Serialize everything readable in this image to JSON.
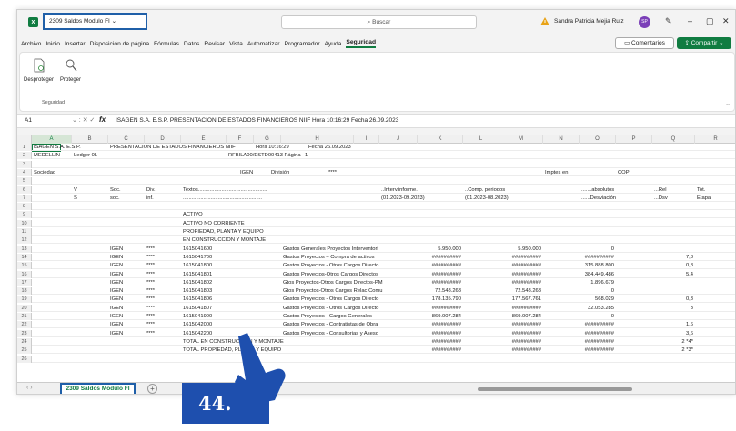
{
  "window": {
    "doc_title": "2309 Saldos Modulo FI",
    "search_placeholder": "Buscar",
    "user_name": "Sandra Patricia Mejia Ruiz",
    "avatar_initials": "SP"
  },
  "menu": {
    "items": [
      "Archivo",
      "Inicio",
      "Insertar",
      "Disposición de página",
      "Fórmulas",
      "Datos",
      "Revisar",
      "Vista",
      "Automatizar",
      "Programador",
      "Ayuda",
      "Seguridad"
    ],
    "comments_label": "Comentarios",
    "share_label": "Compartir"
  },
  "ribbon": {
    "unprotect_label": "Desproteger",
    "protect_label": "Proteger",
    "group_label": "Seguridad"
  },
  "formula_bar": {
    "name_box": "A1",
    "fx": "fx",
    "content": "ISAGEN S.A. E.S.P.          PRESENTACION DE ESTADOS FINANCIEROS NIIF          Hora 10:16:29   Fecha 26.09.2023"
  },
  "sheet": {
    "columns": [
      "A",
      "B",
      "C",
      "D",
      "E",
      "F",
      "G",
      "H",
      "I",
      "J",
      "K",
      "L",
      "M",
      "N",
      "O",
      "P",
      "Q",
      "R"
    ],
    "rows": [
      {
        "n": "1",
        "cells": [
          [
            "A",
            "ISAGEN S.A. E.S.P."
          ],
          [
            "C",
            "PRESENTACION DE ESTADOS FINANCIEROS NIIF"
          ],
          [
            "G",
            "Hora 10:16:29"
          ],
          [
            "H2",
            "Fecha 26.09.2023"
          ]
        ]
      },
      {
        "n": "2",
        "cells": [
          [
            "A",
            "MEDELLIN"
          ],
          [
            "B",
            "Ledger 0L"
          ],
          [
            "E2",
            "RFBILA00/ESTD00413 Página"
          ],
          [
            "G2",
            "1"
          ]
        ]
      },
      {
        "n": "3",
        "cells": []
      },
      {
        "n": "4",
        "cells": [
          [
            "A",
            "Sociedad"
          ],
          [
            "F0",
            "IGEN"
          ],
          [
            "G0",
            "División"
          ],
          [
            "H3",
            "****"
          ],
          [
            "N",
            "Imptes en"
          ],
          [
            "P",
            "COP"
          ]
        ]
      },
      {
        "n": "5",
        "cells": []
      },
      {
        "n": "6",
        "cells": [
          [
            "B",
            "V"
          ],
          [
            "C",
            "Soc."
          ],
          [
            "D",
            "Div."
          ],
          [
            "E",
            "Textos..............................................."
          ],
          [
            "J",
            "..Interv.informe."
          ],
          [
            "L",
            "..Comp. periodos"
          ],
          [
            "O",
            ".......absolutos"
          ],
          [
            "Q",
            "...Rel"
          ],
          [
            "R",
            "Tot."
          ]
        ]
      },
      {
        "n": "7",
        "cells": [
          [
            "B",
            "S"
          ],
          [
            "C",
            "soc."
          ],
          [
            "D",
            "inf."
          ],
          [
            "E",
            "......................................................"
          ],
          [
            "J",
            "(01.2023-09.2023)"
          ],
          [
            "L",
            "(01.2023-08.2023)"
          ],
          [
            "O",
            "......Desviación"
          ],
          [
            "Q",
            "...Dsv"
          ],
          [
            "R",
            "Etapa"
          ]
        ]
      },
      {
        "n": "8",
        "cells": []
      },
      {
        "n": "9",
        "cells": [
          [
            "E",
            "ACTIVO"
          ]
        ]
      },
      {
        "n": "10",
        "cells": [
          [
            "E",
            "ACTIVO NO CORRIENTE"
          ]
        ]
      },
      {
        "n": "11",
        "cells": [
          [
            "E",
            "PROPIEDAD, PLANTA Y EQUIPO"
          ]
        ]
      },
      {
        "n": "12",
        "cells": [
          [
            "E",
            "EN CONSTRUCCION Y MONTAJE"
          ]
        ]
      },
      {
        "n": "13",
        "cells": [
          [
            "C",
            "IGEN"
          ],
          [
            "D",
            "****"
          ],
          [
            "E",
            "1615041600"
          ],
          [
            "H",
            "Gastos Generales Proyectos Interventori"
          ],
          [
            "Kr",
            "5.950.000"
          ],
          [
            "Mr",
            "5.950.000"
          ],
          [
            "Or",
            "0"
          ]
        ]
      },
      {
        "n": "14",
        "cells": [
          [
            "C",
            "IGEN"
          ],
          [
            "D",
            "****"
          ],
          [
            "E",
            "1615041700"
          ],
          [
            "H",
            "Gastos Proyectos – Compra de activos"
          ],
          [
            "Kr",
            "##########"
          ],
          [
            "Mr",
            "##########"
          ],
          [
            "Or",
            "##########"
          ],
          [
            "Qr",
            "7,8"
          ]
        ]
      },
      {
        "n": "15",
        "cells": [
          [
            "C",
            "IGEN"
          ],
          [
            "D",
            "****"
          ],
          [
            "E",
            "1615041800"
          ],
          [
            "H",
            "Gastos Proyectos - Otros Cargos Directo"
          ],
          [
            "Kr",
            "##########"
          ],
          [
            "Mr",
            "##########"
          ],
          [
            "Or",
            "315.888.800"
          ],
          [
            "Qr",
            "0,8"
          ]
        ]
      },
      {
        "n": "16",
        "cells": [
          [
            "C",
            "IGEN"
          ],
          [
            "D",
            "****"
          ],
          [
            "E",
            "1615041801"
          ],
          [
            "H",
            "Gastos Proyectos-Otros Cargos Directos"
          ],
          [
            "Kr",
            "##########"
          ],
          [
            "Mr",
            "##########"
          ],
          [
            "Or",
            "384.449.486"
          ],
          [
            "Qr",
            "5,4"
          ]
        ]
      },
      {
        "n": "17",
        "cells": [
          [
            "C",
            "IGEN"
          ],
          [
            "D",
            "****"
          ],
          [
            "E",
            "1615041802"
          ],
          [
            "H",
            "Gtos Proyectos-Otros Cargos Directos-PM"
          ],
          [
            "Kr",
            "##########"
          ],
          [
            "Mr",
            "##########"
          ],
          [
            "Or",
            "1.896.679"
          ]
        ]
      },
      {
        "n": "18",
        "cells": [
          [
            "C",
            "IGEN"
          ],
          [
            "D",
            "****"
          ],
          [
            "E",
            "1615041803"
          ],
          [
            "H",
            "Gtos Proyectos-Otros Cargos Relac.Comu"
          ],
          [
            "Kr",
            "72.548.263"
          ],
          [
            "Mr",
            "72.548.263"
          ],
          [
            "Or",
            "0"
          ]
        ]
      },
      {
        "n": "19",
        "cells": [
          [
            "C",
            "IGEN"
          ],
          [
            "D",
            "****"
          ],
          [
            "E",
            "1615041806"
          ],
          [
            "H",
            "Gastos Proyectos - Otros Cargos Directo"
          ],
          [
            "Kr",
            "178.135.790"
          ],
          [
            "Mr",
            "177.567.761"
          ],
          [
            "Or",
            "568.029"
          ],
          [
            "Qr",
            "0,3"
          ]
        ]
      },
      {
        "n": "20",
        "cells": [
          [
            "C",
            "IGEN"
          ],
          [
            "D",
            "****"
          ],
          [
            "E",
            "1615041807"
          ],
          [
            "H",
            "Gastos Proyectos - Otros Cargos Directo"
          ],
          [
            "Kr",
            "##########"
          ],
          [
            "Mr",
            "##########"
          ],
          [
            "Or",
            "32.053.285"
          ],
          [
            "Qr",
            "3"
          ]
        ]
      },
      {
        "n": "21",
        "cells": [
          [
            "C",
            "IGEN"
          ],
          [
            "D",
            "****"
          ],
          [
            "E",
            "1615041900"
          ],
          [
            "H",
            "Gastos Proyectos - Cargos Generales"
          ],
          [
            "Kr",
            "869.007.284"
          ],
          [
            "Mr",
            "869.007.284"
          ],
          [
            "Or",
            "0"
          ]
        ]
      },
      {
        "n": "22",
        "cells": [
          [
            "C",
            "IGEN"
          ],
          [
            "D",
            "****"
          ],
          [
            "E",
            "1615042000"
          ],
          [
            "H",
            "Gastos Proyectos - Contratistas de Obra"
          ],
          [
            "Kr",
            "##########"
          ],
          [
            "Mr",
            "##########"
          ],
          [
            "Or",
            "##########"
          ],
          [
            "Qr",
            "1,6"
          ]
        ]
      },
      {
        "n": "23",
        "cells": [
          [
            "C",
            "IGEN"
          ],
          [
            "D",
            "****"
          ],
          [
            "E",
            "1615042200"
          ],
          [
            "H",
            "Gastos Proyectos - Consultorias y Aseso"
          ],
          [
            "Kr",
            "##########"
          ],
          [
            "Mr",
            "##########"
          ],
          [
            "Or",
            "##########"
          ],
          [
            "Qr",
            "3,6"
          ]
        ]
      },
      {
        "n": "24",
        "cells": [
          [
            "E",
            "TOTAL EN CONSTRUCCION Y MONTAJE"
          ],
          [
            "Kr",
            "##########"
          ],
          [
            "Mr",
            "##########"
          ],
          [
            "Or",
            "##########"
          ],
          [
            "Qr",
            "2 *4*"
          ]
        ]
      },
      {
        "n": "25",
        "cells": [
          [
            "E",
            "TOTAL PROPIEDAD, PLANTA Y EQUIPO"
          ],
          [
            "Kr",
            "##########"
          ],
          [
            "Mr",
            "##########"
          ],
          [
            "Or",
            "##########"
          ],
          [
            "Qr",
            "2 *3*"
          ]
        ]
      },
      {
        "n": "26",
        "cells": []
      }
    ]
  },
  "tabs": {
    "active_sheet": "2309 Saldos Modulo FI",
    "add_sheet": "+"
  },
  "step_badge": "44."
}
